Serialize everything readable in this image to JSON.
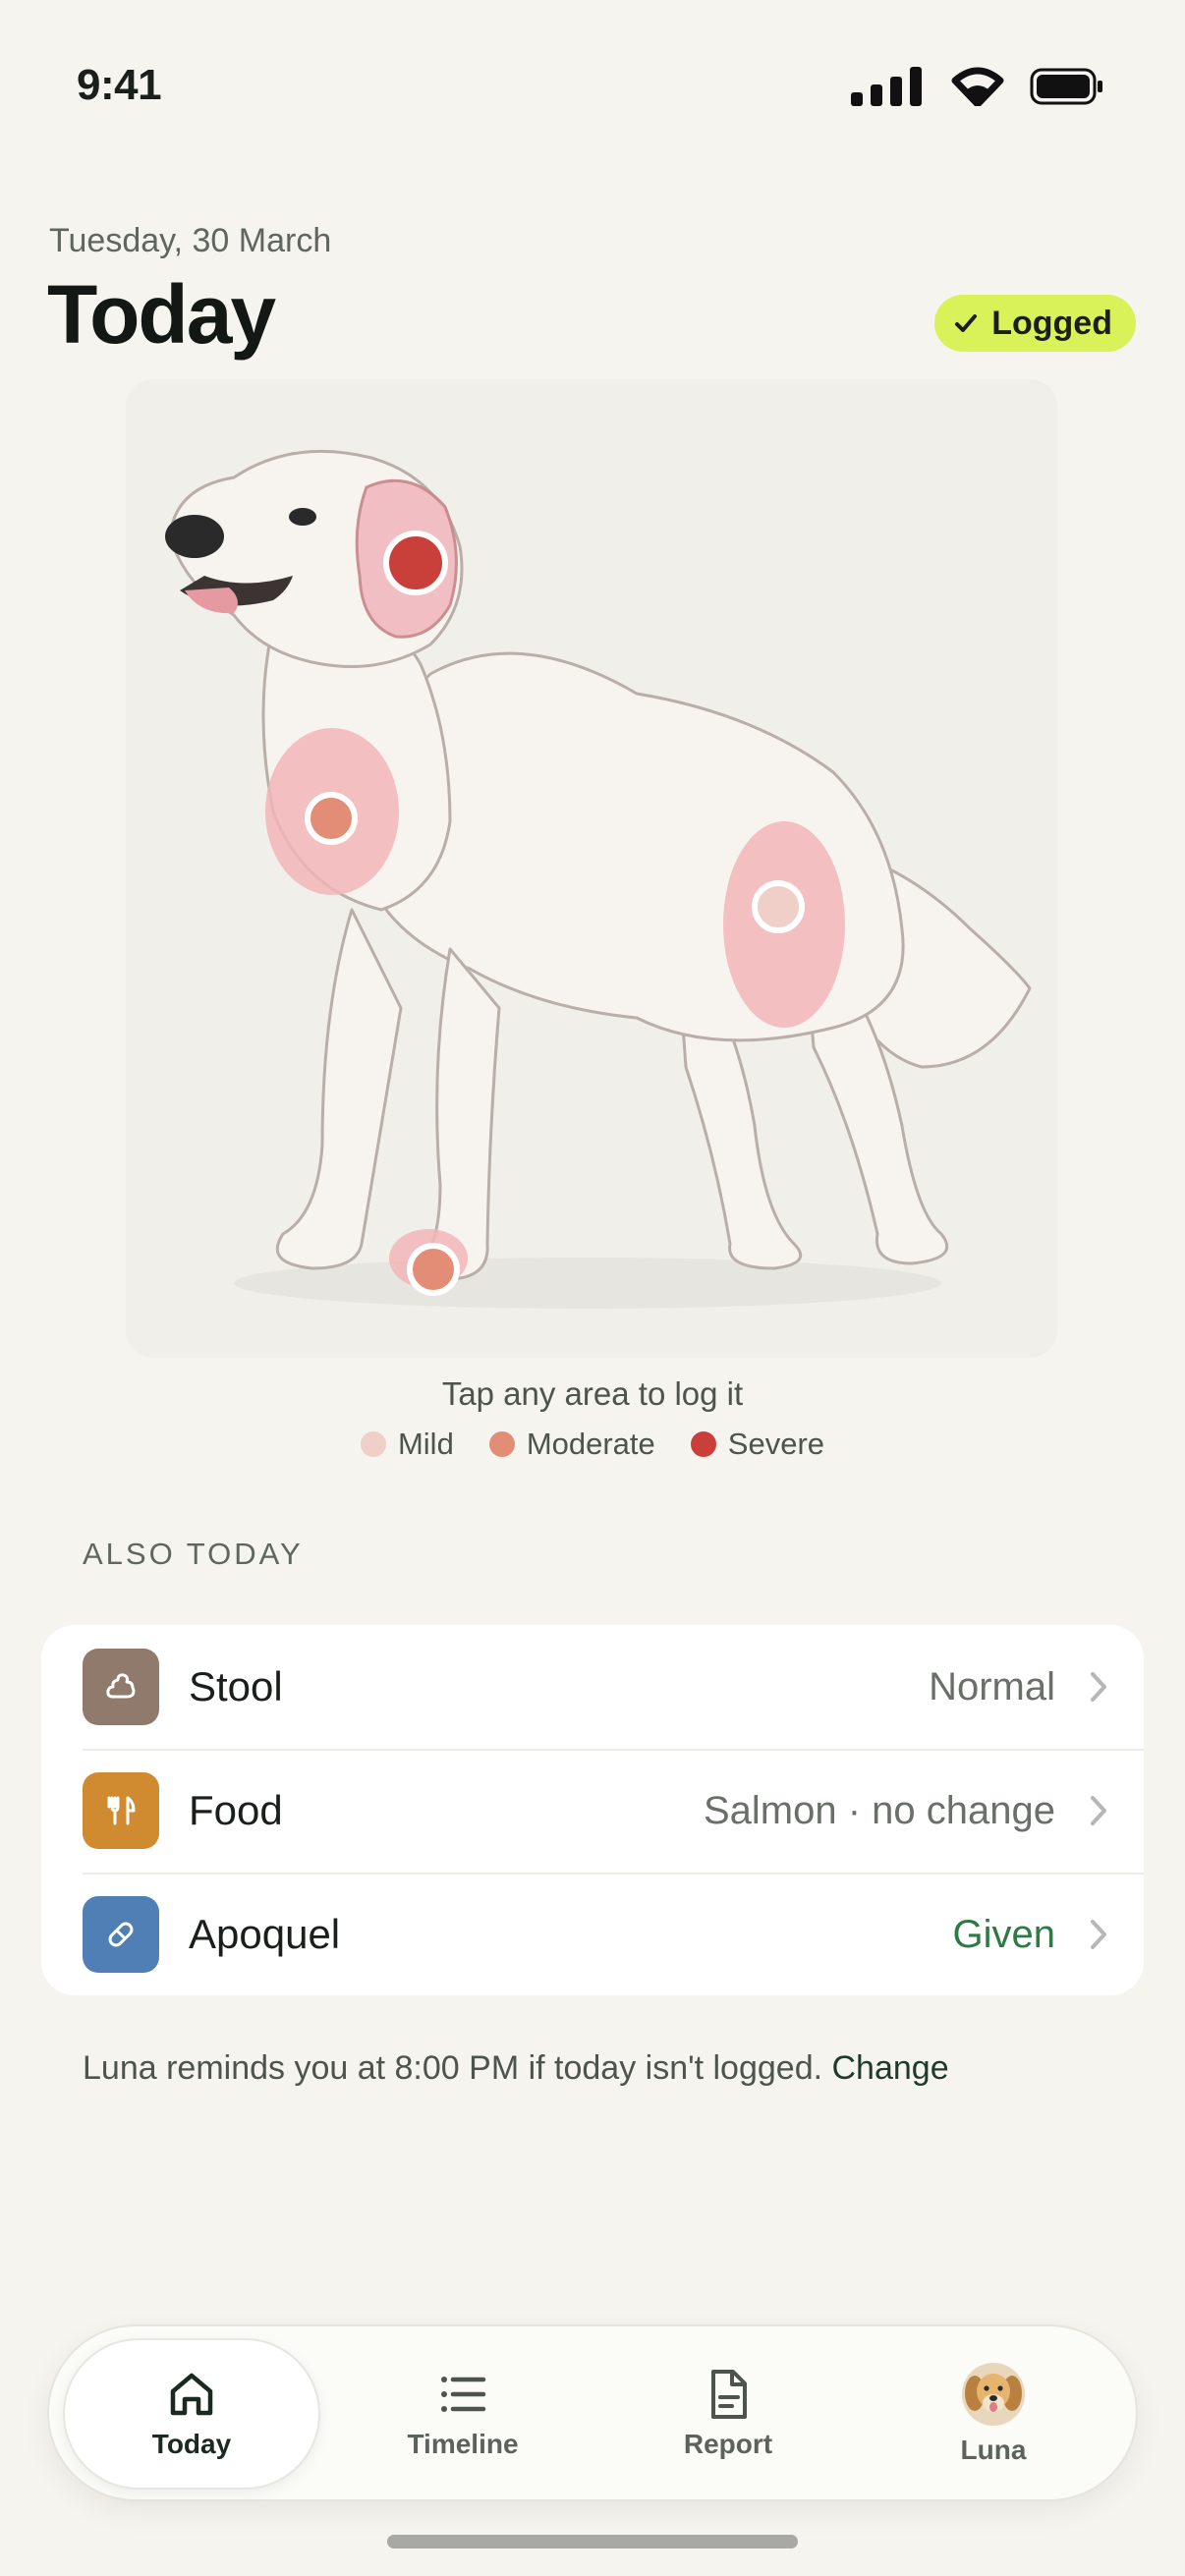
{
  "status_bar": {
    "time": "9:41"
  },
  "header": {
    "date": "Tuesday, 30 March",
    "title": "Today",
    "badge": "Logged"
  },
  "body_map": {
    "hint": "Tap any area to log it",
    "hotspots": [
      {
        "area": "ear",
        "severity": "Severe"
      },
      {
        "area": "chest",
        "severity": "Moderate"
      },
      {
        "area": "hip",
        "severity": "Mild"
      },
      {
        "area": "front paw",
        "severity": "Moderate"
      }
    ],
    "legend": [
      {
        "label": "Mild",
        "color": "#efcfc8"
      },
      {
        "label": "Moderate",
        "color": "#e38c76"
      },
      {
        "label": "Severe",
        "color": "#c9403a"
      }
    ]
  },
  "also_today": {
    "section_label": "ALSO TODAY",
    "rows": [
      {
        "label": "Stool",
        "value": "Normal",
        "icon": "stool-icon",
        "color": "#8f7a6b"
      },
      {
        "label": "Food",
        "value": "Salmon · no change",
        "icon": "fork-knife-icon",
        "color": "#d08a30"
      },
      {
        "label": "Apoquel",
        "value": "Given",
        "icon": "pill-icon",
        "color": "#4f7fb5"
      }
    ]
  },
  "reminder": {
    "text": "Luna reminds you at 8:00 PM if today isn't logged.",
    "action": "Change"
  },
  "tabbar": {
    "tabs": [
      {
        "label": "Today",
        "icon": "home-icon",
        "active": true
      },
      {
        "label": "Timeline",
        "icon": "list-icon",
        "active": false
      },
      {
        "label": "Report",
        "icon": "document-icon",
        "active": false
      },
      {
        "label": "Luna",
        "icon": "dog-avatar",
        "active": false
      }
    ]
  },
  "colors": {
    "accent_badge": "#d9f25a",
    "given": "#2e7a44",
    "background": "#f5f4ef"
  }
}
